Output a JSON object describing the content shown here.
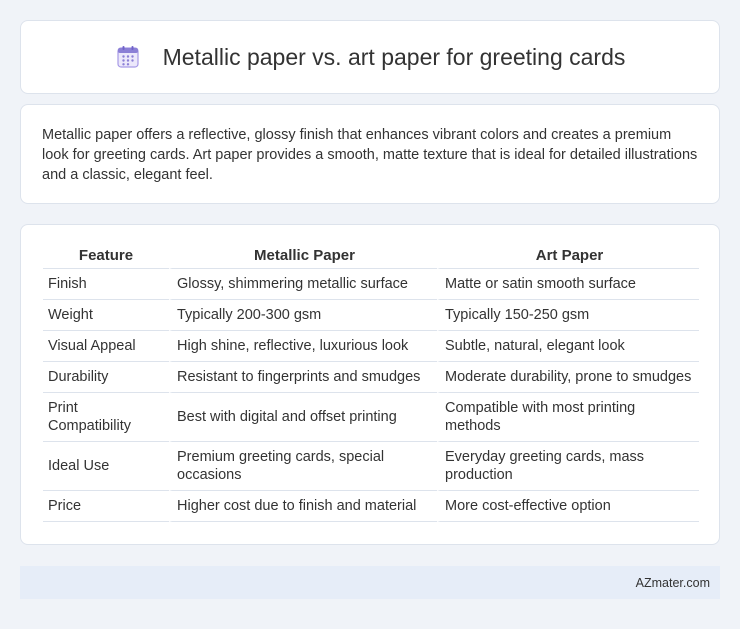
{
  "header": {
    "title": "Metallic paper vs. art paper for greeting cards",
    "icon": "calendar-icon",
    "icon_color": "#8b7fd6"
  },
  "intro": {
    "text": "Metallic paper offers a reflective, glossy finish that enhances vibrant colors and creates a premium look for greeting cards. Art paper provides a smooth, matte texture that is ideal for detailed illustrations and a classic, elegant feel."
  },
  "table": {
    "headers": [
      "Feature",
      "Metallic Paper",
      "Art Paper"
    ],
    "rows": [
      [
        "Finish",
        "Glossy, shimmering metallic surface",
        "Matte or satin smooth surface"
      ],
      [
        "Weight",
        "Typically 200-300 gsm",
        "Typically 150-250 gsm"
      ],
      [
        "Visual Appeal",
        "High shine, reflective, luxurious look",
        "Subtle, natural, elegant look"
      ],
      [
        "Durability",
        "Resistant to fingerprints and smudges",
        "Moderate durability, prone to smudges"
      ],
      [
        "Print Compatibility",
        "Best with digital and offset printing",
        "Compatible with most printing methods"
      ],
      [
        "Ideal Use",
        "Premium greeting cards, special occasions",
        "Everyday greeting cards, mass production"
      ],
      [
        "Price",
        "Higher cost due to finish and material",
        "More cost-effective option"
      ]
    ]
  },
  "footer": {
    "text": "AZmater.com"
  },
  "colors": {
    "background": "#f0f3f8",
    "card": "#ffffff",
    "footer_bg": "#e6edf8",
    "border": "#dde3ec",
    "text": "#333333"
  }
}
